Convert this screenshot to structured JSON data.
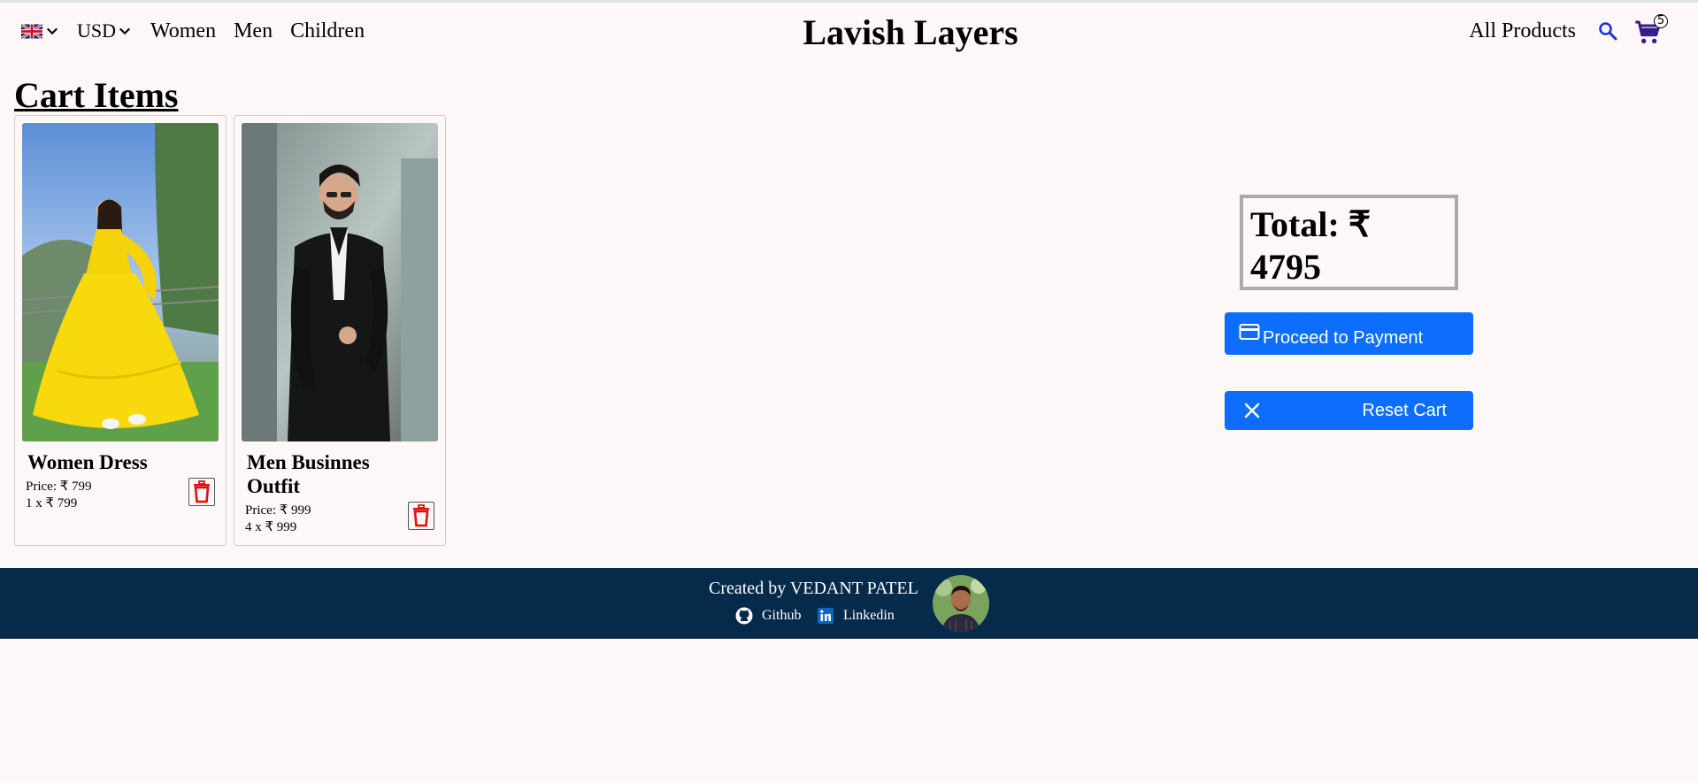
{
  "header": {
    "language_flag": "uk-flag-icon",
    "currency": "USD",
    "nav": [
      "Women",
      "Men",
      "Children"
    ],
    "brand": "Lavish Layers",
    "all_products": "All Products",
    "cart_count": "5"
  },
  "cart": {
    "title": "Cart Items",
    "items": [
      {
        "name": "Women Dress",
        "price": "Price: ₹ 799",
        "qty_line": "1 x ₹ 799"
      },
      {
        "name": "Men Businnes Outfit",
        "price": "Price: ₹ 999",
        "qty_line": "4 x ₹ 999"
      }
    ]
  },
  "summary": {
    "total": "Total: ₹ 4795",
    "pay_label": "Proceed to Payment",
    "reset_label": "Reset Cart"
  },
  "footer": {
    "credit": "Created by VEDANT PATEL",
    "github": "Github",
    "linkedin": "Linkedin"
  },
  "colors": {
    "accent": "#0d6efd",
    "footer_bg": "#062a4a",
    "delete": "#e01010",
    "icon_blue": "#1a35d6",
    "cart_icon": "#3a1a8a"
  }
}
